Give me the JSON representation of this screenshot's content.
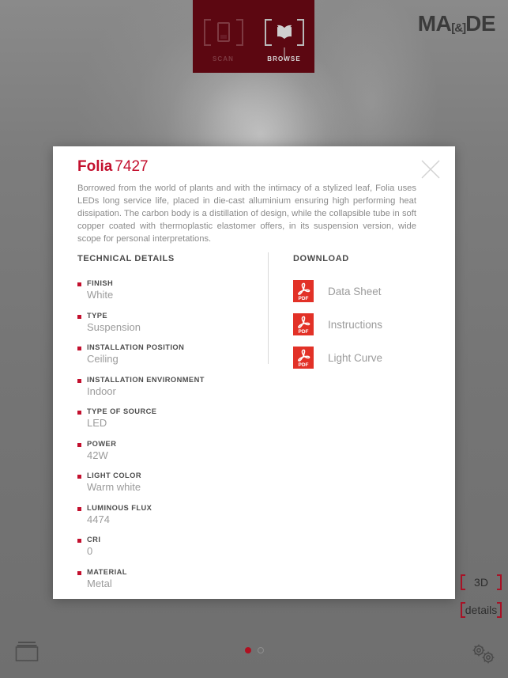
{
  "topbar": {
    "tabs": [
      {
        "label": "SCAN",
        "icon": "phone-icon",
        "active": false
      },
      {
        "label": "BROWSE",
        "icon": "book-icon",
        "active": true
      }
    ],
    "logo": {
      "part1": "MA",
      "amp": "[&]",
      "part2": "DE"
    }
  },
  "modal": {
    "close_icon": "close-icon",
    "title": {
      "name": "Folia",
      "code": "7427"
    },
    "description": "Borrowed from the world of plants and with the intimacy of a stylized leaf, Folia uses LEDs long service life, placed in die-cast alluminium ensuring high performing heat dissipation. The carbon body is a distillation of design, while the collapsible tube in soft copper coated with thermoplastic elastomer offers, in its suspension version, wide scope for personal interpretations.",
    "technical": {
      "heading": "TECHNICAL DETAILS",
      "items": [
        {
          "label": "FINISH",
          "value": "White"
        },
        {
          "label": "TYPE",
          "value": "Suspension"
        },
        {
          "label": "INSTALLATION POSITION",
          "value": "Ceiling"
        },
        {
          "label": "INSTALLATION ENVIRONMENT",
          "value": "Indoor"
        },
        {
          "label": "TYPE OF SOURCE",
          "value": "LED"
        },
        {
          "label": "POWER",
          "value": "42W"
        },
        {
          "label": "LIGHT COLOR",
          "value": "Warm white"
        },
        {
          "label": "LUMINOUS FLUX",
          "value": "4474"
        },
        {
          "label": "CRI",
          "value": "0"
        },
        {
          "label": "MATERIAL",
          "value": "Metal"
        }
      ]
    },
    "download": {
      "heading": "DOWNLOAD",
      "items": [
        {
          "label": "Data Sheet",
          "icon": "pdf-icon",
          "badge": "PDF"
        },
        {
          "label": "Instructions",
          "icon": "pdf-icon",
          "badge": "PDF"
        },
        {
          "label": "Light Curve",
          "icon": "pdf-icon",
          "badge": "PDF"
        }
      ]
    }
  },
  "bottom": {
    "card_icon": "card-stack-icon",
    "gear_icon": "settings-gears-icon",
    "pagination": [
      {
        "state": "active"
      },
      {
        "state": "inactive"
      }
    ],
    "side_buttons": [
      {
        "label": "3D"
      },
      {
        "label": "details"
      }
    ]
  },
  "colors": {
    "brand_red": "#c3102e",
    "dark_red_panel": "#5c0711",
    "pdf_red": "#e23127",
    "bg_gray": "#777777",
    "label_gray": "#4d4d4d",
    "value_gray": "#9b9b9b"
  }
}
